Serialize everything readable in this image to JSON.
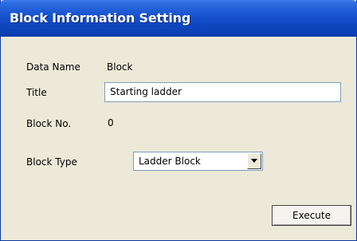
{
  "window": {
    "title": "Block Information Setting"
  },
  "form": {
    "data_name": {
      "label": "Data Name",
      "value": "Block"
    },
    "title": {
      "label": "Title",
      "value": "Starting ladder"
    },
    "block_no": {
      "label": "Block No.",
      "value": "0"
    },
    "block_type": {
      "label": "Block Type",
      "selected": "Ladder Block"
    }
  },
  "actions": {
    "execute_label": "Execute"
  },
  "icons": {
    "dropdown": "chevron-down-icon"
  },
  "colors": {
    "titlebar": "#0f47c2",
    "dialog_background": "#ece9d8",
    "title_text": "#ffffff"
  }
}
